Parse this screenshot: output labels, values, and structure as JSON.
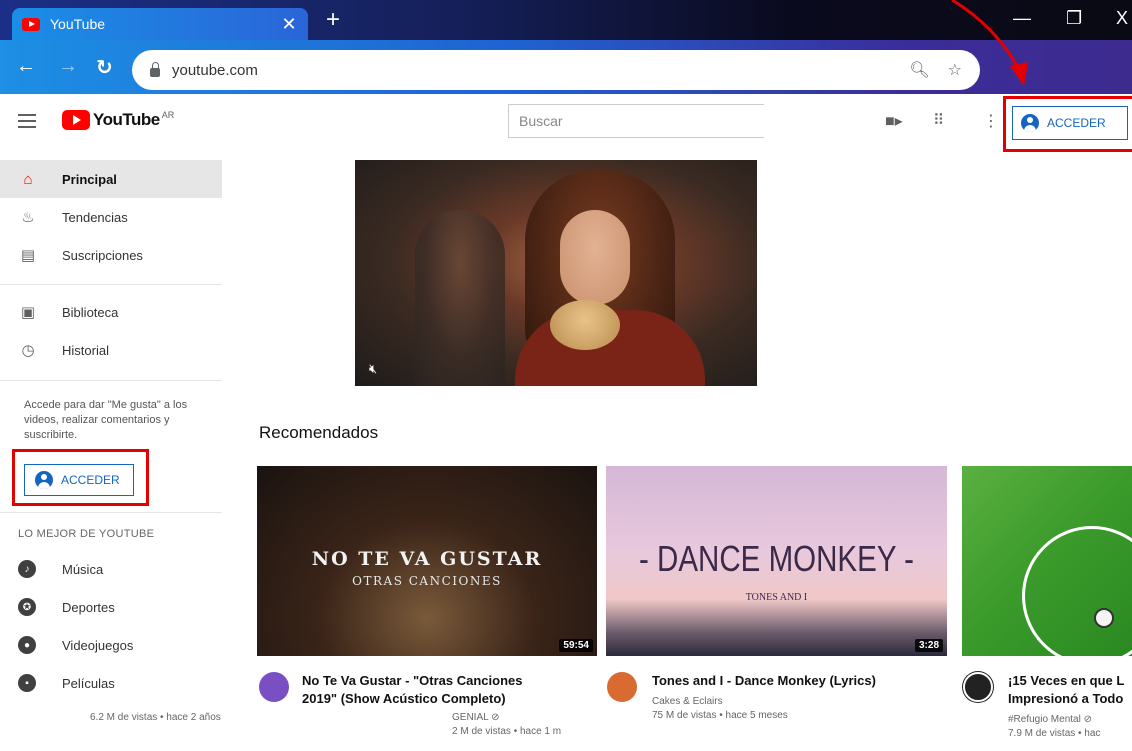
{
  "browser": {
    "tab_title": "YouTube",
    "tab_close": "✕",
    "new_tab": "+",
    "url": "youtube.com",
    "window_controls": {
      "minimize": "—",
      "restore": "❐",
      "close": "X"
    }
  },
  "header": {
    "logo_text": "YouTube",
    "country_code": "AR",
    "search_placeholder": "Buscar",
    "signin_label": "ACCEDER"
  },
  "sidebar": {
    "items": [
      {
        "label": "Principal",
        "icon": "home-icon",
        "active": true
      },
      {
        "label": "Tendencias",
        "icon": "flame-icon"
      },
      {
        "label": "Suscripciones",
        "icon": "subscriptions-icon"
      },
      {
        "label": "Biblioteca",
        "icon": "library-icon"
      },
      {
        "label": "Historial",
        "icon": "history-icon"
      }
    ],
    "promo_text": "Accede para dar \"Me gusta\" a los videos, realizar comentarios y suscribirte.",
    "signin_label": "ACCEDER",
    "best_of_title": "LO MEJOR DE YOUTUBE",
    "best_of": [
      {
        "label": "Música",
        "icon": "music-icon"
      },
      {
        "label": "Deportes",
        "icon": "sports-icon"
      },
      {
        "label": "Videojuegos",
        "icon": "gaming-icon"
      },
      {
        "label": "Películas",
        "icon": "movies-icon"
      }
    ]
  },
  "main": {
    "section_title": "Recomendados",
    "videos": [
      {
        "thumb_title": "NO TE VA GUSTAR",
        "thumb_subtitle": "OTRAS CANCIONES",
        "duration": "59:54",
        "title_line1": "No Te Va Gustar - \"Otras Canciones",
        "title_line2": "2019\" (Show Acústico Completo)",
        "channel": "GENIAL ⊘",
        "meta": "2 M de vistas • hace 1 m",
        "avatar_color": "#7b4fc4"
      },
      {
        "thumb_title": "- DANCE MONKEY -",
        "thumb_subtitle": "TONES AND I",
        "duration": "3:28",
        "title_line1": "Tones and I - Dance Monkey (Lyrics)",
        "channel": "Cakes & Eclairs",
        "meta": "75 M de vistas • hace 5 meses",
        "avatar_color": "#d86a32"
      },
      {
        "title_line1": "¡15 Veces en que L",
        "title_line2": "Impresionó a Todo",
        "channel": "#Refugio Mental ⊘",
        "meta": "7.9 M de vistas • hac",
        "avatar_color": "#222222"
      }
    ],
    "below_meta": "6.2 M de vistas • hace 2 años"
  },
  "colors": {
    "brand_red": "#ff0000",
    "link_blue": "#1565c0",
    "annotation_red": "#e50000"
  }
}
